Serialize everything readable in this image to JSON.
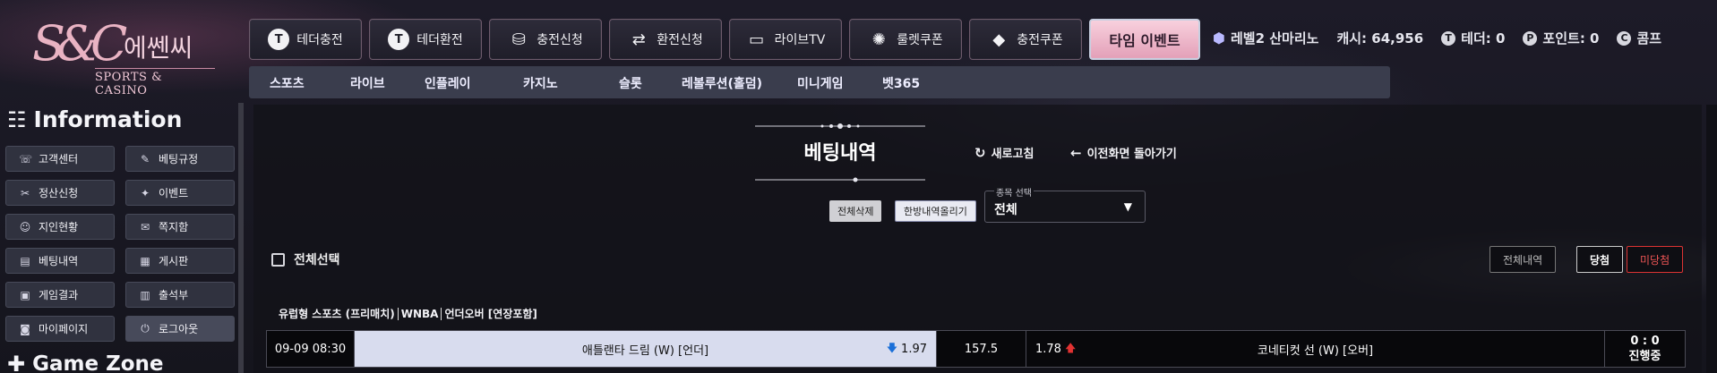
{
  "logo": {
    "mark": "S&C",
    "title": "에쎈씨",
    "subtitle": "SPORTS & CASINO"
  },
  "topnav": [
    {
      "label": "테더충전",
      "icon": "T"
    },
    {
      "label": "테더환전",
      "icon": "T"
    },
    {
      "label": "충전신청",
      "icon": "coins-icon"
    },
    {
      "label": "환전신청",
      "icon": "exchange-icon"
    },
    {
      "label": "라이브TV",
      "icon": "tv-icon"
    },
    {
      "label": "룰렛쿠폰",
      "icon": "roulette-icon"
    },
    {
      "label": "충전쿠폰",
      "icon": "coupon-icon"
    },
    {
      "label": "타임 이벤트"
    }
  ],
  "userinfo": {
    "level": "레벨2 산마리노",
    "cash": "캐시: 64,956",
    "tether": "테더: 0",
    "points": "포인트: 0",
    "comp": "콤프"
  },
  "subnav": [
    "스포츠",
    "라이브",
    "인플레이",
    "카지노",
    "슬롯",
    "레볼루션(홀덤)",
    "미니게임",
    "벳365"
  ],
  "sidebar": {
    "info_title": "Information",
    "items": [
      {
        "label": "고객센터",
        "icon": "phone-icon"
      },
      {
        "label": "베팅규정",
        "icon": "rules-icon"
      },
      {
        "label": "정산신청",
        "icon": "settle-icon"
      },
      {
        "label": "이벤트",
        "icon": "event-icon"
      },
      {
        "label": "지인현황",
        "icon": "friends-icon"
      },
      {
        "label": "쪽지함",
        "icon": "message-icon"
      },
      {
        "label": "베팅내역",
        "icon": "bet-history-icon"
      },
      {
        "label": "게시판",
        "icon": "board-icon"
      },
      {
        "label": "게임결과",
        "icon": "result-icon"
      },
      {
        "label": "출석부",
        "icon": "calendar-icon"
      },
      {
        "label": "마이페이지",
        "icon": "user-icon"
      },
      {
        "label": "로그아웃",
        "icon": "power-icon"
      }
    ],
    "game_title": "Game Zone"
  },
  "main": {
    "title": "베팅내역",
    "refresh": "새로고침",
    "back": "이전화면 돌아가기",
    "delete_all": "전체삭제",
    "upload": "한방내역올리기",
    "select_legend": "종목 선택",
    "select_value": "전체",
    "select_all": "전체선택",
    "filters": {
      "all": "전체내역",
      "win": "당첨",
      "lose": "미당첨"
    },
    "bet": {
      "category": "유럽형 스포츠 (프리매치)",
      "league": "WNBA",
      "market": "언더오버 [연장포함]",
      "time": "09-09 08:30",
      "home": "애틀랜타 드림 (W) [언더]",
      "home_odds": "1.97",
      "line": "157.5",
      "away_odds": "1.78",
      "away": "코네티컷 선 (W) [오버]",
      "score": "0 : 0",
      "status": "진행중"
    }
  }
}
